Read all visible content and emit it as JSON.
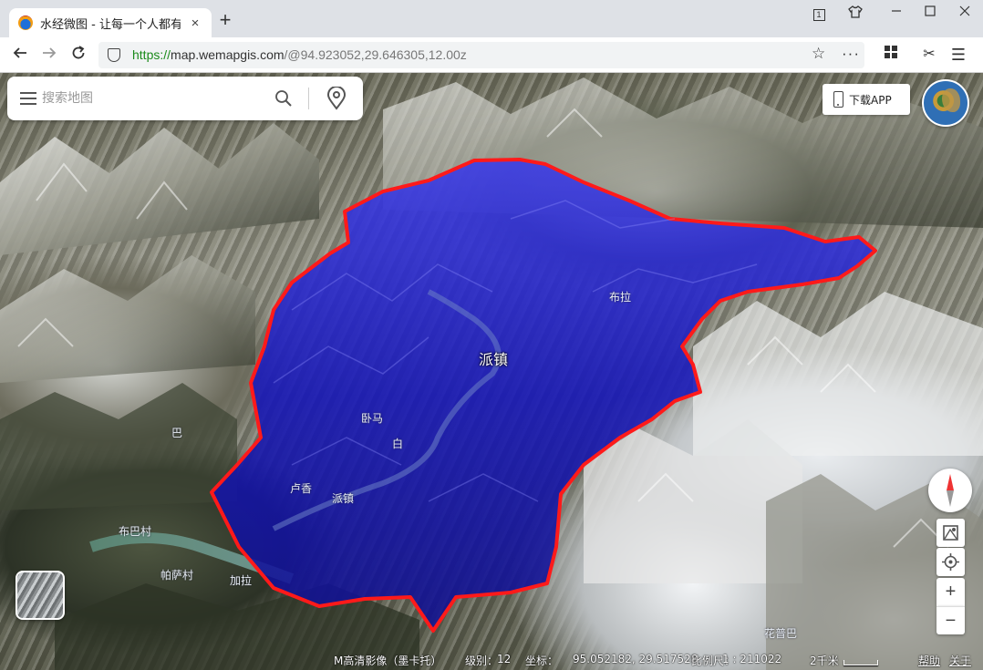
{
  "browser": {
    "tab_title": "水经微图 - 让每一个人都有自",
    "tab_close": "×",
    "new_tab": "+",
    "url_scheme": "https://",
    "url_host": "map.wemapgis.com",
    "url_path": "/@94.923052,29.646305,12.00z",
    "icons": [
      "tab-counter-icon",
      "shirt-icon",
      "minimize-icon",
      "maximize-icon",
      "close-icon",
      "back-icon",
      "forward-icon",
      "reload-icon",
      "shield-icon",
      "star-icon",
      "more-icon",
      "apps-grid-icon",
      "scissors-icon",
      "menu-icon"
    ],
    "tab_counter": "1"
  },
  "search": {
    "placeholder": "搜索地图"
  },
  "download": {
    "label": "下载APP"
  },
  "map": {
    "town_label": "派镇",
    "place_labels": [
      "巴",
      "卧马",
      "白",
      "卢香",
      "派镇",
      "布巴村",
      "帕萨村",
      "加拉",
      "花普巴",
      "布拉"
    ],
    "polygon_fill": "#1a1ad9",
    "polygon_stroke": "#ff1a1a"
  },
  "controls": {
    "zoom_in": "+",
    "zoom_out": "−"
  },
  "status": {
    "layer": "M高清影像（墨卡托）",
    "level_label": "级别：",
    "level_value": "12",
    "coord_label": "坐标：",
    "coord_value": "95.052182, 29.517528",
    "scale_label": "比例尺：",
    "scale_value": "1 : 211022",
    "distance": "2千米",
    "help": "帮助",
    "about": "关于"
  }
}
